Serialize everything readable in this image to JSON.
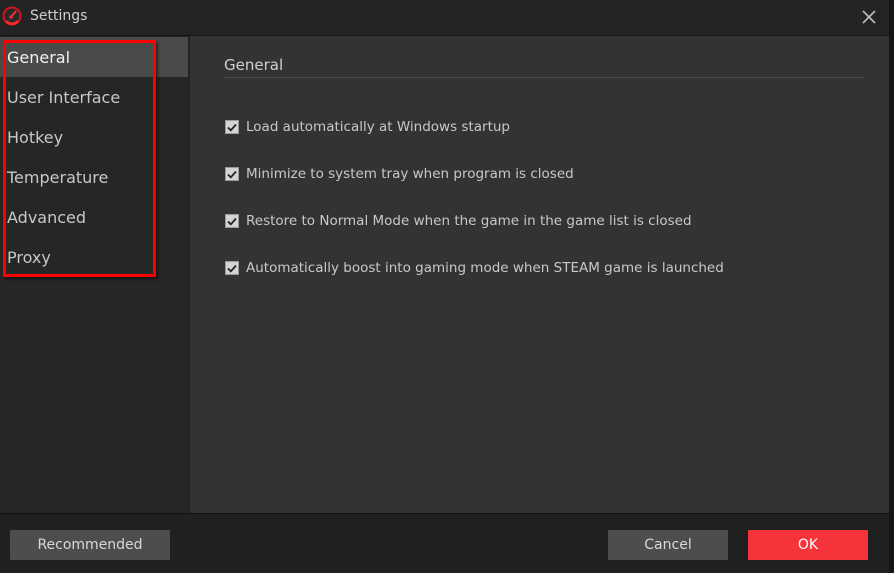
{
  "window": {
    "title": "Settings",
    "app_icon": "speedometer-icon",
    "close_icon": "close-icon"
  },
  "sidebar": {
    "items": [
      {
        "label": "General",
        "active": true
      },
      {
        "label": "User Interface",
        "active": false
      },
      {
        "label": "Hotkey",
        "active": false
      },
      {
        "label": "Temperature",
        "active": false
      },
      {
        "label": "Advanced",
        "active": false
      },
      {
        "label": "Proxy",
        "active": false
      }
    ]
  },
  "main": {
    "section_title": "General",
    "options": [
      {
        "label": "Load automatically at Windows startup",
        "checked": true
      },
      {
        "label": "Minimize to system tray when program is closed",
        "checked": true
      },
      {
        "label": "Restore to Normal Mode when the game in the game list is closed",
        "checked": true
      },
      {
        "label": "Automatically boost into gaming mode when STEAM game is launched",
        "checked": true
      }
    ]
  },
  "footer": {
    "recommended_label": "Recommended",
    "cancel_label": "Cancel",
    "ok_label": "OK"
  },
  "colors": {
    "accent": "#f5333a",
    "annotation": "#ff0000"
  }
}
